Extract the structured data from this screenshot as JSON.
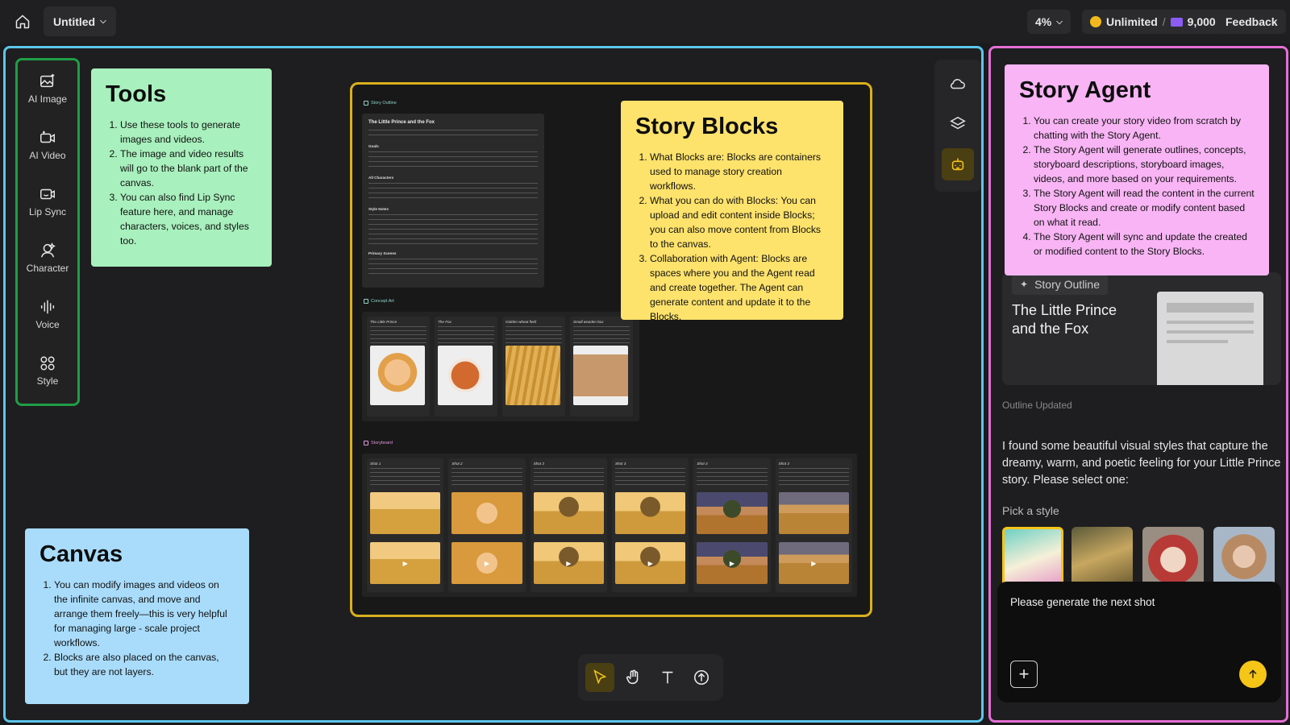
{
  "topbar": {
    "project_title": "Untitled",
    "zoom": "4%",
    "plan_label": "Unlimited",
    "separator": "/",
    "credits": "9,000",
    "feedback_label": "Feedback"
  },
  "tools": {
    "items": [
      {
        "label": "AI Image",
        "icon": "image-sparkle-icon"
      },
      {
        "label": "AI Video",
        "icon": "video-sparkle-icon"
      },
      {
        "label": "Lip Sync",
        "icon": "lip-sync-icon"
      },
      {
        "label": "Character",
        "icon": "character-icon"
      },
      {
        "label": "Voice",
        "icon": "voice-icon"
      },
      {
        "label": "Style",
        "icon": "style-icon"
      }
    ]
  },
  "notes": {
    "tools": {
      "title": "Tools",
      "color": "#a8f0bd",
      "items": [
        "Use these tools to generate images and videos.",
        "The image and video results will go to the blank part of the canvas.",
        "You can also find Lip Sync feature here, and manage characters, voices, and styles too."
      ]
    },
    "canvas": {
      "title": "Canvas",
      "color": "#a9dcfb",
      "items": [
        "You can modify images and videos on the infinite canvas, and move and arrange them freely—this is very helpful for managing large - scale project workflows.",
        "Blocks are also placed on the canvas, but they are not layers."
      ]
    },
    "story_blocks": {
      "title": "Story Blocks",
      "color": "#fde26c",
      "items": [
        "What Blocks are: Blocks are containers used to manage story creation workflows.",
        "What you can do with Blocks: You can upload and edit content inside Blocks; you can also move content from Blocks to the canvas.",
        "Collaboration with Agent: Blocks are spaces where you and the Agent read and create together. The Agent can generate content and update it to the Blocks."
      ]
    },
    "story_agent": {
      "title": "Story Agent",
      "color": "#f8b4f4",
      "items": [
        "You can create your story video from scratch by chatting with the Story Agent.",
        "The Story Agent will generate outlines, concepts, storyboard descriptions, storyboard images, videos, and more based on your requirements.",
        "The Story Agent will read the content in the current Story Blocks and create or modify content based on what it read.",
        "The Story Agent will sync and update the created or modified content to the Story Blocks."
      ]
    }
  },
  "blocks": {
    "outline_label": "Story Outline",
    "outline_title": "The Little Prince and the Fox",
    "outline_sections": [
      "Goals",
      "All Characters",
      "Style Notes",
      "Primary Scenes"
    ],
    "concept_label": "Concept Art",
    "concepts": [
      {
        "name": "The Little Prince",
        "color": "#e3a552"
      },
      {
        "name": "The Fox",
        "color": "#c9632c"
      },
      {
        "name": "Golden wheat field",
        "color": "#d9a544"
      },
      {
        "name": "Small wooden box",
        "color": "#b98a62"
      }
    ],
    "storyboard_label": "Storyboard",
    "shots": [
      "Shot 1",
      "Shot 2",
      "Shot 3",
      "Shot 3",
      "Shot 3",
      "Shot 3"
    ]
  },
  "agent": {
    "outline_chip": "Story Outline",
    "outline_card_title": "The Little Prince and the Fox",
    "status": "Outline Updated",
    "message": "I found some beautiful visual styles that capture the dreamy, warm, and poetic feeling for your Little Prince story. Please select one:",
    "pick_label": "Pick a style",
    "styles": [
      {
        "name": "style-1",
        "color": "#7fc1a0"
      },
      {
        "name": "style-2",
        "color": "#8c7a45"
      },
      {
        "name": "style-3",
        "color": "#c0524b"
      },
      {
        "name": "style-4",
        "color": "#9a8f86"
      }
    ],
    "input_value": "Please generate the next shot"
  },
  "colors": {
    "canvas_border": "#5cc6ec",
    "agent_border": "#e56fd5",
    "tools_border": "#1f9d46",
    "blocks_border": "#d9b01d",
    "accent": "#f5c518"
  }
}
